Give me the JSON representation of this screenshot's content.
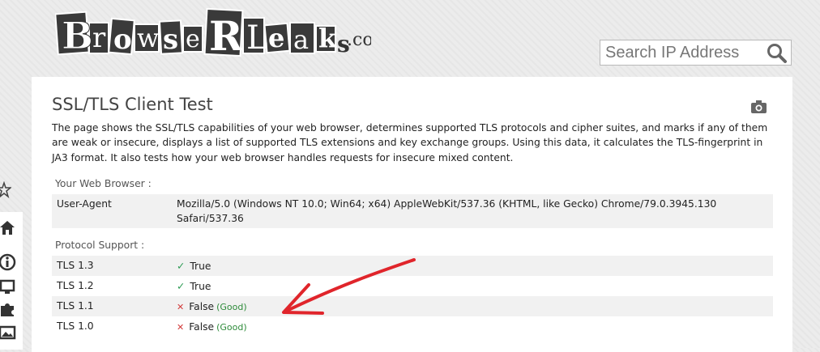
{
  "logo": {
    "text": "BrowseRLeaks.com"
  },
  "search": {
    "placeholder": "Search IP Address"
  },
  "page": {
    "title": "SSL/TLS Client Test",
    "description": "The page shows the SSL/TLS capabilities of your web browser, determines supported TLS protocols and cipher suites, and marks if any of them are weak or insecure, displays a list of supported TLS extensions and key exchange groups. Using this data, it calculates the TLS-fingerprint in JA3 format. It also tests how your web browser handles requests for insecure mixed content."
  },
  "browser": {
    "label": "Your Web Browser :",
    "user_agent_key": "User-Agent",
    "user_agent_value": "Mozilla/5.0 (Windows NT 10.0; Win64; x64) AppleWebKit/537.36 (KHTML, like Gecko) Chrome/79.0.3945.130 Safari/537.36"
  },
  "protocols": {
    "label": "Protocol Support :",
    "rows": [
      {
        "name": "TLS 1.3",
        "mark": "✓",
        "value": "True",
        "note": ""
      },
      {
        "name": "TLS 1.2",
        "mark": "✓",
        "value": "True",
        "note": ""
      },
      {
        "name": "TLS 1.1",
        "mark": "✕",
        "value": "False",
        "note": "(Good)"
      },
      {
        "name": "TLS 1.0",
        "mark": "✕",
        "value": "False",
        "note": "(Good)"
      }
    ]
  },
  "colors": {
    "ok": "#2e9b55",
    "bad": "#d23b3b",
    "good": "#2e8b3a",
    "annotation_arrow": "#e0252b"
  },
  "icons": [
    "search-icon",
    "camera-icon",
    "star-icon",
    "home-icon",
    "info-icon",
    "screen-icon",
    "puzzle-icon",
    "image-icon"
  ]
}
